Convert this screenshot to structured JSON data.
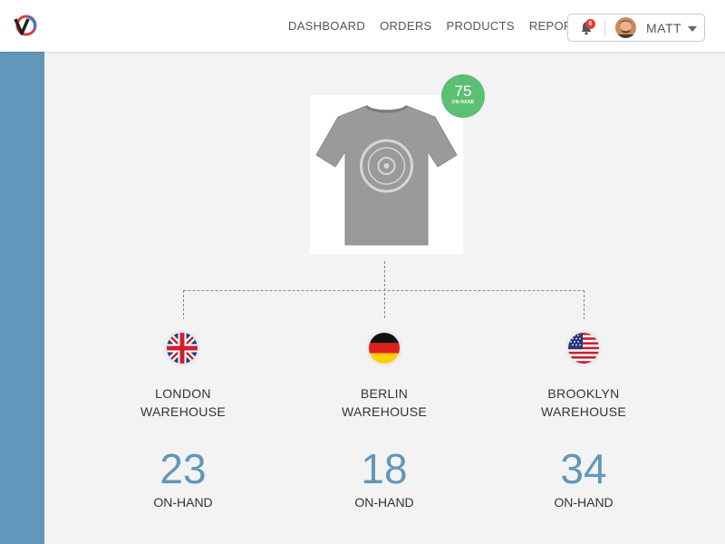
{
  "nav": {
    "items": [
      "DASHBOARD",
      "ORDERS",
      "PRODUCTS",
      "REPORTS"
    ]
  },
  "user": {
    "name": "MATT",
    "notifications": "6"
  },
  "product": {
    "total_on_hand": "75",
    "total_label": "ON-HAND"
  },
  "warehouses": [
    {
      "line1": "LONDON",
      "line2": "WAREHOUSE",
      "count": "23",
      "label": "ON-HAND",
      "flag_icon": "uk-flag-icon"
    },
    {
      "line1": "BERLIN",
      "line2": "WAREHOUSE",
      "count": "18",
      "label": "ON-HAND",
      "flag_icon": "germany-flag-icon"
    },
    {
      "line1": "BROOKLYN",
      "line2": "WAREHOUSE",
      "count": "34",
      "label": "ON-HAND",
      "flag_icon": "usa-flag-icon"
    }
  ],
  "colors": {
    "sidebar": "#6197ba",
    "accent_number": "#6197ba",
    "badge_green": "#5cbf73",
    "notification_red": "#e8372f"
  }
}
